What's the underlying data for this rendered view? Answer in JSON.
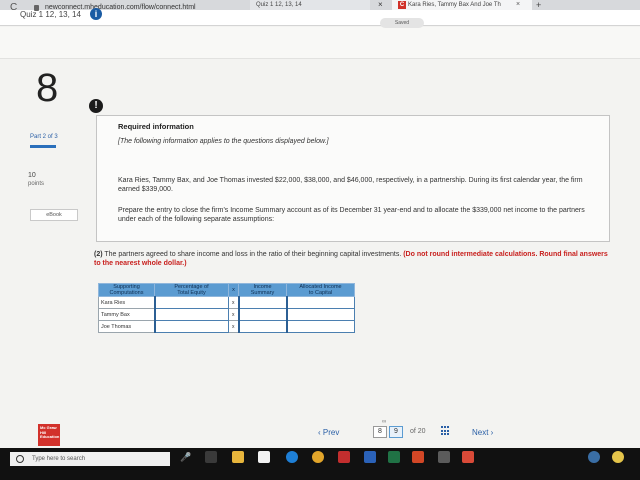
{
  "browser": {
    "tab1_title": "Quiz 1 12, 13, 14",
    "tab2_title": "Kara Ries, Tammy Bax And Joe Th",
    "tab2_icon_letter": "C",
    "close_glyph": "×",
    "newtab_glyph": "+",
    "reload_glyph": "C",
    "url": "newconnect.mheducation.com/flow/connect.html"
  },
  "quiz": {
    "title": "Quiz 1 12, 13, 14",
    "info_glyph": "i",
    "saved_label": "Saved"
  },
  "left": {
    "question_number": "8",
    "part_label": "Part 2 of 3",
    "points_value": "10",
    "points_label": "points",
    "ebook_label": "eBook"
  },
  "required_info": {
    "alert_glyph": "!",
    "title": "Required information",
    "note": "[The following information applies to the questions displayed below.]",
    "paragraph1": "Kara Ries, Tammy Bax, and Joe Thomas invested $22,000, $38,000, and $46,000, respectively, in a partnership. During its first calendar year, the firm earned $339,000.",
    "paragraph2": "Prepare the entry to close the firm's Income Summary account as of its December 31 year-end and to allocate the $339,000 net income to the partners under each of the following separate assumptions:"
  },
  "question": {
    "lead": "(2)",
    "text": " The partners agreed to share income and loss in the ratio of their beginning capital investments. ",
    "warning": "(Do not round intermediate calculations. Round final answers to the nearest whole dollar.)"
  },
  "table": {
    "headers": {
      "col0_line1": "Supporting",
      "col0_line2": "Computations",
      "col1_line1": "Percentage of",
      "col1_line2": "Total Equity",
      "x": "x",
      "col3_line1": "Income",
      "col3_line2": "Summary",
      "col4_line1": "Allocated Income",
      "col4_line2": "to Capital"
    },
    "rows": [
      {
        "name": "Kara Ries",
        "x": "x"
      },
      {
        "name": "Tammy Bax",
        "x": "x"
      },
      {
        "name": "Joe Thomas",
        "x": "x"
      }
    ]
  },
  "footer": {
    "logo_text": "Mc Graw Hill Education",
    "prev_label": "‹  Prev",
    "page_current": "8",
    "page_next": "9",
    "page_of": "of  20",
    "next_label": "Next  ›",
    "pager_glyph": "∞"
  },
  "taskbar": {
    "search_placeholder": "Type here to search",
    "mic_glyph": "🎤"
  }
}
